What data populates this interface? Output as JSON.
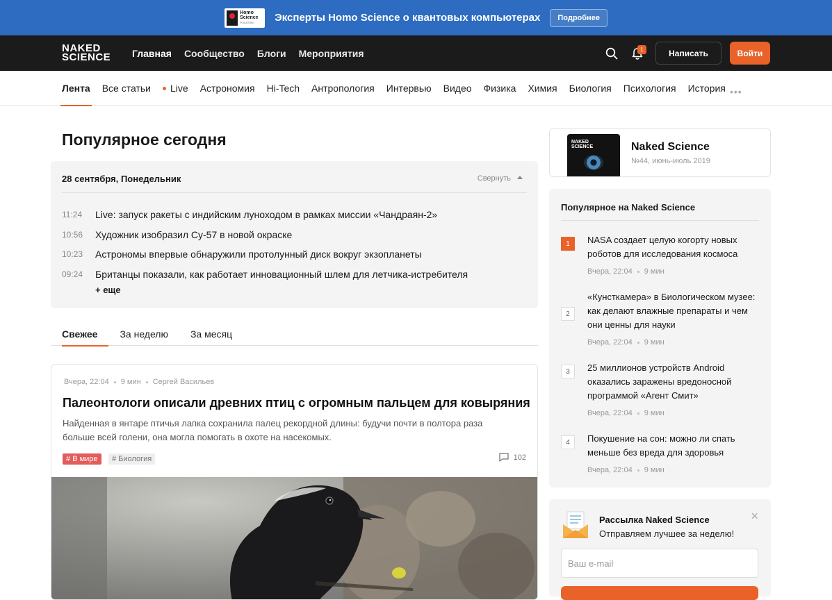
{
  "promo": {
    "logo_line1": "Homo",
    "logo_line2": "Science",
    "logo_sub": "РОСАТОМ",
    "text": "Эксперты Homo Science о квантовых компьютерах",
    "button": "Подробнее"
  },
  "header": {
    "logo_line1": "NAKED",
    "logo_line2": "SCIENCE",
    "nav": [
      "Главная",
      "Сообщество",
      "Блоги",
      "Мероприятия"
    ],
    "notifications_count": "1",
    "write_button": "Написать",
    "login_button": "Войти"
  },
  "categories": [
    "Лента",
    "Все статьи",
    "Live",
    "Астрономия",
    "Hi-Tech",
    "Антропология",
    "Интервью",
    "Видео",
    "Физика",
    "Химия",
    "Биология",
    "Психология",
    "История"
  ],
  "more_dots": "•••",
  "popular_today": {
    "title": "Популярное сегодня",
    "date": "28 сентября, Понедельник",
    "collapse": "Свернуть",
    "items": [
      {
        "time": "11:24",
        "title": "Live: запуск ракеты с индийским луноходом в рамках миссии «Чандраян-2»"
      },
      {
        "time": "10:56",
        "title": "Художник изобразил Су-57 в новой окраске"
      },
      {
        "time": "10:23",
        "title": "Астрономы впервые обнаружили протолунный диск вокруг экзопланеты"
      },
      {
        "time": "09:24",
        "title": "Британцы показали, как работает инновационный шлем для летчика-истребителя"
      }
    ],
    "more": "+ еще"
  },
  "tabs": [
    "Свежее",
    "За неделю",
    "За месяц"
  ],
  "article": {
    "date": "Вчера, 22:04",
    "read_time": "9 мин",
    "author": "Сергей Васильев",
    "title": "Палеонтологи описали древних птиц с огромным пальцем для ковыряния",
    "lead": "Найденная в янтаре птичья лапка сохранила палец рекордной длины: будучи почти в полтора раза больше всей голени, она могла помогать в охоте на насекомых.",
    "tag1": "# В мире",
    "tag2": "# Биология",
    "comments": "102"
  },
  "magazine": {
    "cover_line1": "NAKED",
    "cover_line2": "SCIENCE",
    "name": "Naked Science",
    "issue": "№44, июнь-июль 2019"
  },
  "popular_site": {
    "title": "Популярное на Naked Science",
    "items": [
      {
        "num": "1",
        "title": "NASA создает целую когорту новых роботов для исследования космоса",
        "date": "Вчера, 22:04",
        "read": "9 мин"
      },
      {
        "num": "2",
        "title": "«Кунсткамера» в Биологическом музее: как делают влажные препараты и чем они ценны для науки",
        "date": "Вчера, 22:04",
        "read": "9 мин"
      },
      {
        "num": "3",
        "title": "25 миллионов устройств Android оказались заражены вредоносной программой «Агент Смит»",
        "date": "Вчера, 22:04",
        "read": "9 мин"
      },
      {
        "num": "4",
        "title": "Покушение на сон: можно ли спать меньше без вреда для здоровья",
        "date": "Вчера, 22:04",
        "read": "9 мин"
      }
    ]
  },
  "newsletter": {
    "title": "Рассылка Naked Science",
    "subtitle": "Отправляем лучшее за неделю!",
    "close": "×",
    "email_placeholder": "Ваш e-mail"
  },
  "colors": {
    "accent": "#e8622a",
    "promo": "#2d6cc0",
    "header": "#1b1b1b",
    "tag": "#e35b5b"
  }
}
